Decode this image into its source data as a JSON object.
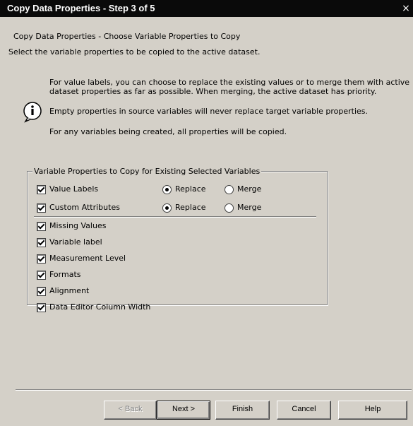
{
  "window": {
    "title": "Copy Data Properties - Step 3 of 5",
    "close_glyph": "×"
  },
  "header": {
    "subtitle": "Copy Data Properties - Choose Variable Properties to Copy",
    "instruction": "Select the variable properties to be copied to the active dataset."
  },
  "info": {
    "icon": "info-icon",
    "line1": "For value labels, you can choose to replace the existing values or to merge them with active",
    "line2": "dataset properties as far as possible.  When merging, the active dataset has priority.",
    "line3": "Empty properties in source variables will never replace target variable properties.",
    "line4": "For any variables being created, all properties will be copied."
  },
  "group": {
    "legend": "Variable Properties to Copy for Existing Selected Variables",
    "value_labels": {
      "label": "Value Labels",
      "checked": true,
      "mode": "Replace"
    },
    "custom_attributes": {
      "label": "Custom Attributes",
      "checked": true,
      "mode": "Replace"
    },
    "replace_label": "Replace",
    "merge_label": "Merge",
    "items": [
      {
        "label": "Missing Values",
        "checked": true
      },
      {
        "label": "Variable label",
        "checked": true
      },
      {
        "label": "Measurement Level",
        "checked": true
      },
      {
        "label": "Formats",
        "checked": true
      },
      {
        "label": "Alignment",
        "checked": true
      },
      {
        "label": "Data Editor Column Width",
        "checked": true
      }
    ]
  },
  "buttons": {
    "back": "< Back",
    "next": "Next >",
    "finish": "Finish",
    "cancel": "Cancel",
    "help": "Help"
  }
}
